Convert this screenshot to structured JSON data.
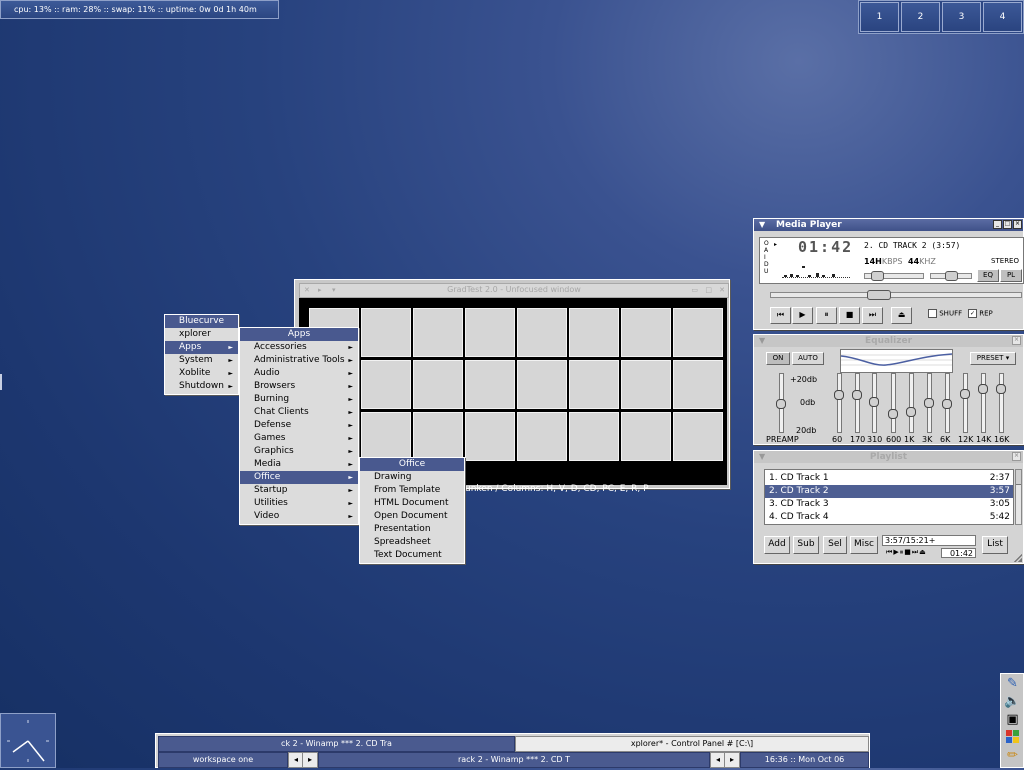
{
  "status_bar": {
    "text": "cpu: 13% :: ram: 28% :: swap: 11% :: uptime: 0w 0d 1h 40m"
  },
  "pager": {
    "workspaces": [
      "1",
      "2",
      "3",
      "4"
    ]
  },
  "root_menu": {
    "title": "Bluecurve",
    "items": [
      {
        "label": "xplorer",
        "submenu": false
      },
      {
        "label": "Apps",
        "submenu": true
      },
      {
        "label": "System",
        "submenu": true
      },
      {
        "label": "Xoblite",
        "submenu": true
      },
      {
        "label": "Shutdown",
        "submenu": true
      }
    ]
  },
  "apps_menu": {
    "title": "Apps",
    "items": [
      "Accessories",
      "Administrative Tools",
      "Audio",
      "Browsers",
      "Burning",
      "Chat Clients",
      "Defense",
      "Games",
      "Graphics",
      "Media",
      "Office",
      "Startup",
      "Utilities",
      "Video"
    ]
  },
  "office_menu": {
    "title": "Office",
    "items": [
      "Drawing",
      "From Template",
      "HTML Document",
      "Open Document",
      "Presentation",
      "Spreadsheet",
      "Text Document"
    ]
  },
  "gradtest": {
    "title": "GradTest 2.0 - Unfocused window",
    "status": "unken / Columns: H, V, D, CD, PC, E, R, P"
  },
  "media_player": {
    "title": "Media Player",
    "time": "01:42",
    "track": "2. CD TRACK 2 (3:57)",
    "kbps_value": "14H",
    "kbps_label": "KBPS",
    "khz_value": "44",
    "khz_label": "KHZ",
    "stereo": "STEREO",
    "eq_label": "EQ",
    "pl_label": "PL",
    "shuffle_label": "SHUFF",
    "repeat_label": "REP",
    "shuffle": false,
    "repeat": true,
    "lcd_side": [
      "O",
      "A",
      "I",
      "D",
      "U"
    ]
  },
  "equalizer": {
    "title": "Equalizer",
    "on_label": "ON",
    "auto_label": "AUTO",
    "preset_label": "PRESET",
    "db_top": "+20db",
    "db_mid": "0db",
    "db_bottom": "20db",
    "preamp_label": "PREAMP",
    "preamp_level": 0.5,
    "bands": [
      {
        "label": "60",
        "level": 0.68
      },
      {
        "label": "170",
        "level": 0.68
      },
      {
        "label": "310",
        "level": 0.55
      },
      {
        "label": "600",
        "level": 0.3
      },
      {
        "label": "1K",
        "level": 0.34
      },
      {
        "label": "3K",
        "level": 0.53
      },
      {
        "label": "6K",
        "level": 0.5
      },
      {
        "label": "12K",
        "level": 0.7
      },
      {
        "label": "14K",
        "level": 0.8
      },
      {
        "label": "16K",
        "level": 0.8
      }
    ]
  },
  "playlist": {
    "title": "Playlist",
    "tracks": [
      {
        "name": "1. CD Track 1",
        "time": "2:37",
        "selected": false
      },
      {
        "name": "2. CD Track 2",
        "time": "3:57",
        "selected": true
      },
      {
        "name": "3. CD Track 3",
        "time": "3:05",
        "selected": false
      },
      {
        "name": "4. CD Track 4",
        "time": "5:42",
        "selected": false
      }
    ],
    "buttons": {
      "add": "Add",
      "sub": "Sub",
      "sel": "Sel",
      "misc": "Misc",
      "list": "List"
    },
    "total_time": "3:57/15:21+",
    "mini_time": "01:42"
  },
  "taskbar": {
    "task_top_left": "ck 2 - Winamp *** 2. CD Tra",
    "task_top_right": "xplorer* - Control Panel # [C:\\]",
    "workspace": "workspace one",
    "task_bottom": "rack 2 - Winamp *** 2. CD T",
    "clock": "16:36 :: Mon Oct 06",
    "arrow_left": "◂",
    "arrow_right": "▸"
  },
  "colors": {
    "accent": "#49598f",
    "desktop": "#27427e",
    "menu_bg": "#dcdcdc"
  }
}
